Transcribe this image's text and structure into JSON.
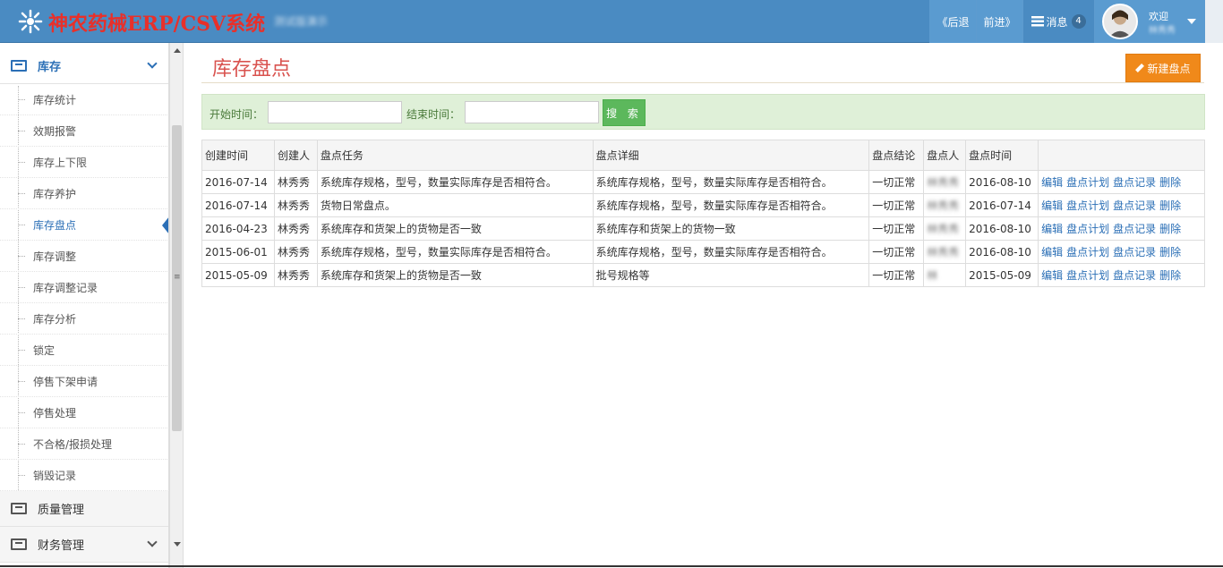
{
  "header": {
    "app_title": "神农药械ERP/CSV系统",
    "app_subtitle": "测试版演示",
    "back_label": "《后退",
    "forward_label": "前进》",
    "messages_label": "消息",
    "messages_count": "4",
    "welcome_label": "欢迎",
    "user_name": "林秀秀"
  },
  "sidebar": {
    "section_label": "库存",
    "items": [
      {
        "label": "库存统计"
      },
      {
        "label": "效期报警"
      },
      {
        "label": "库存上下限"
      },
      {
        "label": "库存养护"
      },
      {
        "label": "库存盘点"
      },
      {
        "label": "库存调整"
      },
      {
        "label": "库存调整记录"
      },
      {
        "label": "库存分析"
      },
      {
        "label": "锁定"
      },
      {
        "label": "停售下架申请"
      },
      {
        "label": "停售处理"
      },
      {
        "label": "不合格/报损处理"
      },
      {
        "label": "销毁记录"
      }
    ],
    "active_index": 4,
    "quality_label": "质量管理",
    "finance_label": "财务管理"
  },
  "page": {
    "title": "库存盘点",
    "new_button": "新建盘点"
  },
  "filter": {
    "start_label": "开始时间：",
    "end_label": "结束时间：",
    "start_value": "",
    "end_value": "",
    "search_button": "搜 索"
  },
  "table": {
    "headers": [
      "创建时间",
      "创建人",
      "盘点任务",
      "盘点详细",
      "盘点结论",
      "盘点人",
      "盘点时间",
      ""
    ],
    "rows": [
      {
        "created": "2016-07-14",
        "creator": "林秀秀",
        "task": "系统库存规格，型号，数量实际库存是否相符合。",
        "detail": "系统库存规格，型号，数量实际库存是否相符合。",
        "result": "一切正常",
        "checker": "林秀秀",
        "check_time": "2016-08-10"
      },
      {
        "created": "2016-07-14",
        "creator": "林秀秀",
        "task": "货物日常盘点。",
        "detail": "系统库存规格，型号，数量实际库存是否相符合。",
        "result": "一切正常",
        "checker": "林秀秀",
        "check_time": "2016-07-14"
      },
      {
        "created": "2016-04-23",
        "creator": "林秀秀",
        "task": "系统库存和货架上的货物是否一致",
        "detail": "系统库存和货架上的货物一致",
        "result": "一切正常",
        "checker": "林秀秀",
        "check_time": "2016-08-10"
      },
      {
        "created": "2015-06-01",
        "creator": "林秀秀",
        "task": "系统库存规格，型号，数量实际库存是否相符合。",
        "detail": "系统库存规格，型号，数量实际库存是否相符合。",
        "result": "一切正常",
        "checker": "林秀秀",
        "check_time": "2016-08-10"
      },
      {
        "created": "2015-05-09",
        "creator": "林秀秀",
        "task": "系统库存和货架上的货物是否一致",
        "detail": "批号规格等",
        "result": "一切正常",
        "checker": "林",
        "check_time": "2015-05-09"
      }
    ],
    "actions": {
      "edit": "编辑",
      "plan": "盘点计划",
      "record": "盘点记录",
      "delete": "删除"
    }
  },
  "colors": {
    "header_bg": "#4a8bc2",
    "title_red": "#d9534f",
    "new_btn": "#f0891a",
    "search_btn": "#5cb85c",
    "link": "#2b6fb6"
  }
}
